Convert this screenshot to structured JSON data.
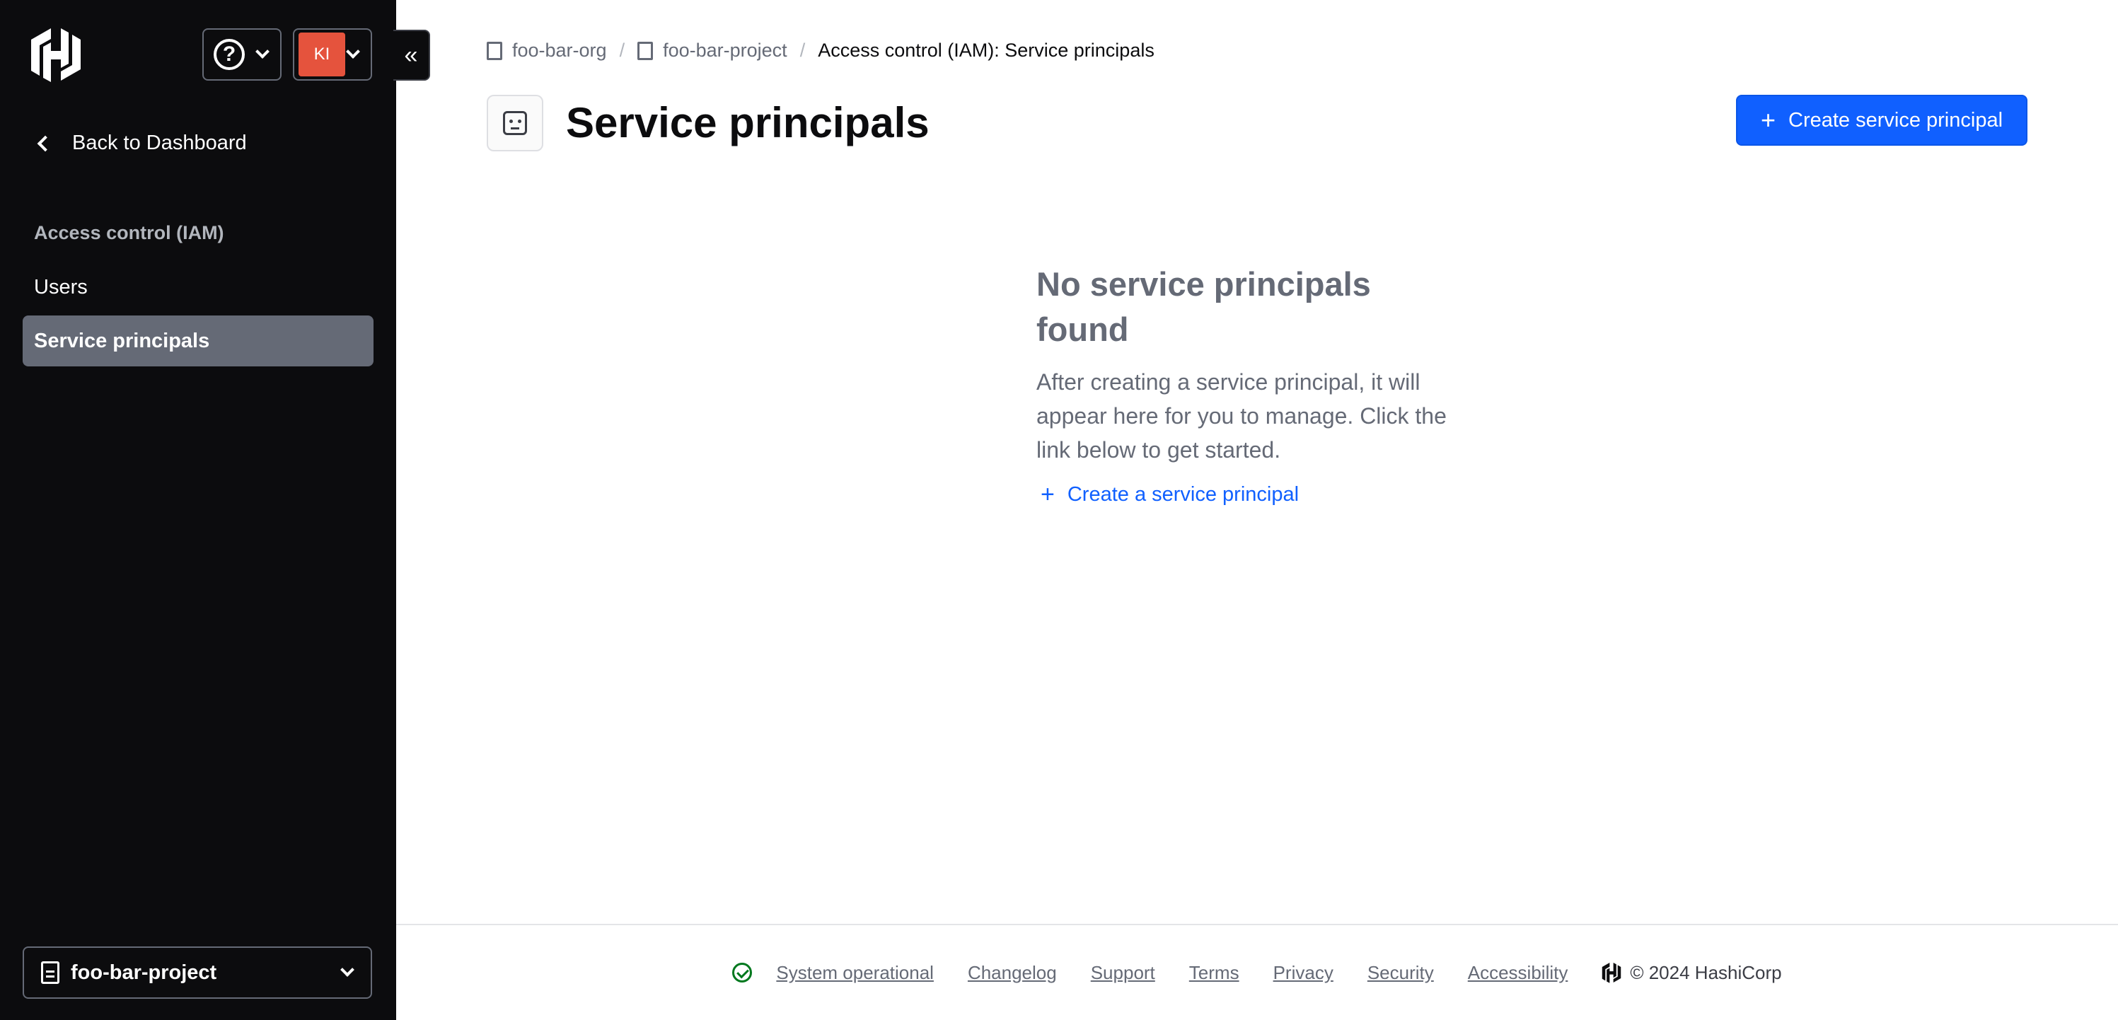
{
  "sidebar": {
    "avatar_initials": "KI",
    "back_label": "Back to Dashboard",
    "section_label": "Access control (IAM)",
    "items": [
      {
        "label": "Users",
        "active": false
      },
      {
        "label": "Service principals",
        "active": true
      }
    ],
    "project_switcher": "foo-bar-project"
  },
  "breadcrumb": {
    "org": "foo-bar-org",
    "project": "foo-bar-project",
    "current": "Access control (IAM): Service principals",
    "separator": "/"
  },
  "header": {
    "title": "Service principals",
    "create_button": "Create service principal"
  },
  "empty_state": {
    "title": "No service principals found",
    "body": "After creating a service principal, it will appear here for you to manage. Click the link below to get started.",
    "link": "Create a service principal"
  },
  "footer": {
    "status": "System operational",
    "links": [
      "Changelog",
      "Support",
      "Terms",
      "Privacy",
      "Security",
      "Accessibility"
    ],
    "copyright": "© 2024 HashiCorp"
  },
  "colors": {
    "sidebar_bg": "#0c0c0e",
    "accent": "#1060ff",
    "avatar": "#e5533d",
    "status_ok": "#00781e"
  }
}
